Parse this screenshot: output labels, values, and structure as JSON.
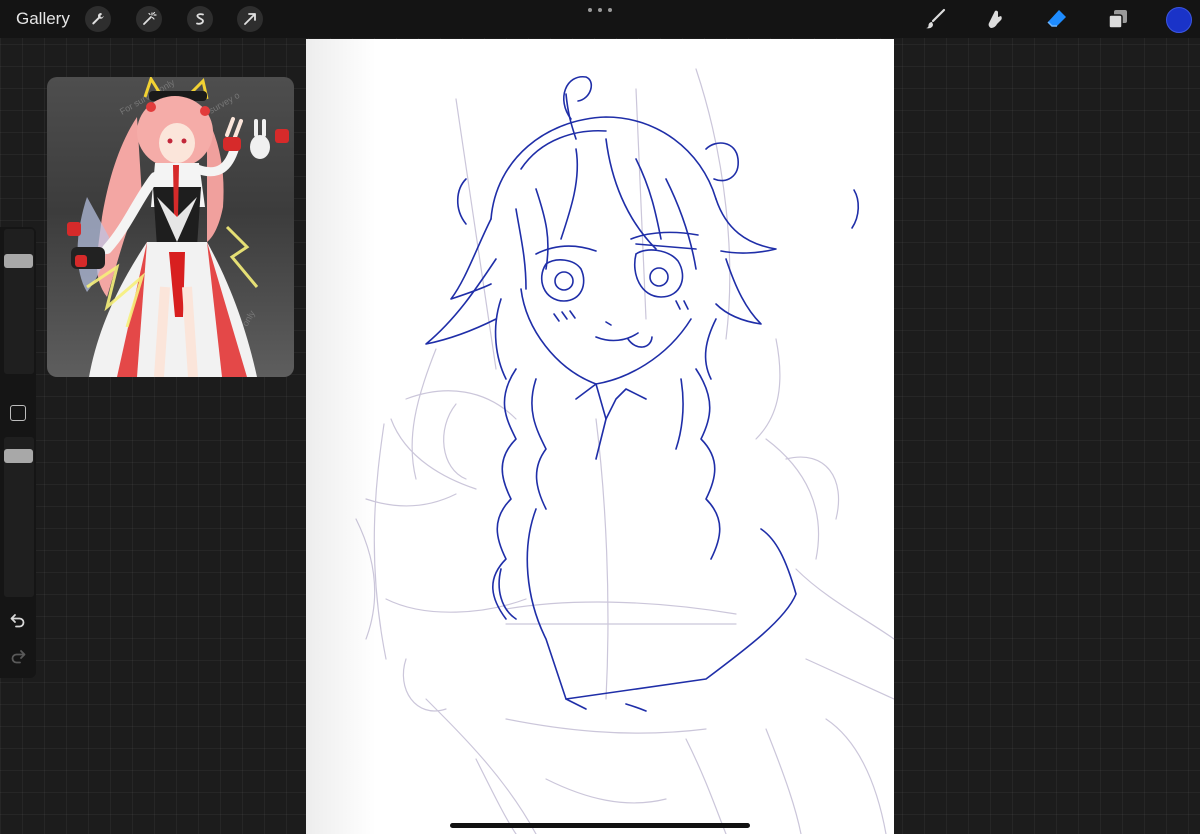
{
  "topbar": {
    "gallery_label": "Gallery",
    "left_tools": [
      "wrench-icon",
      "magic-wand-icon",
      "selection-icon",
      "transform-arrow-icon"
    ],
    "right_tools": [
      "brush-icon",
      "smudge-icon",
      "eraser-icon",
      "layers-icon"
    ],
    "active_tool": "eraser",
    "active_color": "#1a33c8",
    "eraser_color": "#1e8cff"
  },
  "reference_window": {
    "watermark": "For survey only"
  },
  "sidebar": {
    "brush_size_level": 0.22,
    "opacity_level": 0.25
  },
  "canvas": {
    "background": "#ffffff",
    "sketch_color": "#1f2ea8",
    "guide_color": "#c9c4d9"
  }
}
